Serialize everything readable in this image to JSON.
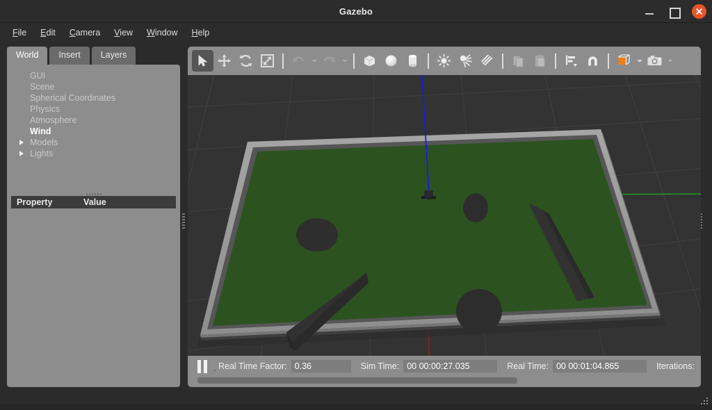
{
  "window": {
    "title": "Gazebo",
    "controls": {
      "minimize": "minimize-button",
      "maximize": "maximize-button",
      "close": "close-button"
    },
    "accent_close": "#e8552a"
  },
  "menubar": {
    "items": [
      {
        "label": "File",
        "mnemonic": "F"
      },
      {
        "label": "Edit",
        "mnemonic": "E"
      },
      {
        "label": "Camera",
        "mnemonic": "C"
      },
      {
        "label": "View",
        "mnemonic": "V"
      },
      {
        "label": "Window",
        "mnemonic": "W"
      },
      {
        "label": "Help",
        "mnemonic": "H"
      }
    ]
  },
  "left_panel": {
    "tabs": [
      {
        "label": "World",
        "active": true
      },
      {
        "label": "Insert",
        "active": false
      },
      {
        "label": "Layers",
        "active": false
      }
    ],
    "tree": [
      {
        "label": "GUI",
        "expandable": false,
        "selected": false
      },
      {
        "label": "Scene",
        "expandable": false,
        "selected": false
      },
      {
        "label": "Spherical Coordinates",
        "expandable": false,
        "selected": false
      },
      {
        "label": "Physics",
        "expandable": false,
        "selected": false
      },
      {
        "label": "Atmosphere",
        "expandable": false,
        "selected": false
      },
      {
        "label": "Wind",
        "expandable": false,
        "selected": true
      },
      {
        "label": "Models",
        "expandable": true,
        "selected": false
      },
      {
        "label": "Lights",
        "expandable": true,
        "selected": false
      }
    ],
    "property_table": {
      "columns": [
        "Property",
        "Value"
      ],
      "rows": []
    }
  },
  "toolbar": {
    "buttons": [
      {
        "name": "select-mode-button",
        "icon": "cursor-arrow-icon",
        "state": "pressed"
      },
      {
        "name": "translate-mode-button",
        "icon": "move-arrows-icon",
        "state": "normal"
      },
      {
        "name": "rotate-mode-button",
        "icon": "rotate-arrows-icon",
        "state": "normal"
      },
      {
        "name": "scale-mode-button",
        "icon": "scale-arrow-icon",
        "state": "normal"
      },
      {
        "name": "undo-button",
        "icon": "undo-arrow-icon",
        "state": "disabled"
      },
      {
        "name": "undo-history-dropdown",
        "icon": "chevron-down-icon",
        "state": "disabled"
      },
      {
        "name": "redo-button",
        "icon": "redo-arrow-icon",
        "state": "disabled"
      },
      {
        "name": "redo-history-dropdown",
        "icon": "chevron-down-icon",
        "state": "disabled"
      },
      {
        "name": "insert-box-button",
        "icon": "box-icon",
        "state": "normal"
      },
      {
        "name": "insert-sphere-button",
        "icon": "sphere-icon",
        "state": "normal"
      },
      {
        "name": "insert-cylinder-button",
        "icon": "cylinder-icon",
        "state": "normal"
      },
      {
        "name": "insert-point-light-button",
        "icon": "point-light-icon",
        "state": "normal"
      },
      {
        "name": "insert-spot-light-button",
        "icon": "spot-light-icon",
        "state": "normal"
      },
      {
        "name": "insert-directional-light-button",
        "icon": "directional-light-icon",
        "state": "normal"
      },
      {
        "name": "copy-button",
        "icon": "copy-icon",
        "state": "disabled"
      },
      {
        "name": "paste-button",
        "icon": "paste-icon",
        "state": "disabled"
      },
      {
        "name": "align-button",
        "icon": "align-icon",
        "state": "normal"
      },
      {
        "name": "snap-button",
        "icon": "magnet-icon",
        "state": "normal"
      },
      {
        "name": "view-angle-button",
        "icon": "orange-cube-icon",
        "state": "normal"
      },
      {
        "name": "screenshot-button",
        "icon": "camera-icon",
        "state": "normal"
      },
      {
        "name": "toolbar-overflow-button",
        "icon": "chevron-down-icon",
        "state": "normal"
      }
    ]
  },
  "statusbar": {
    "pause_button_label": "pause-simulation",
    "real_time_factor_label": "Real Time Factor:",
    "real_time_factor_value": "0.36",
    "sim_time_label": "Sim Time:",
    "sim_time_value": "00 00:00:27.035",
    "real_time_label": "Real Time:",
    "real_time_value": "00 00:01:04.865",
    "iterations_label": "Iterations:",
    "iterations_value": ""
  },
  "viewport": {
    "background_color": "#333333",
    "grid_color": "#454545",
    "axes": {
      "x_axis_color": "#8e2020",
      "y_axis_color": "#1f9c2a",
      "z_axis_color": "#1a1ae0"
    },
    "scene": {
      "name": "walled-arena-with-obstacles",
      "floor_color": "#2c5220",
      "wall_color": "#9a9a9a",
      "wall_shadow_color": "#4a4a4a",
      "obstacle_color": "#2f2f2f",
      "robot": {
        "name": "mobile-robot",
        "color": "#262626"
      },
      "cylinders": 3,
      "boxes": 2
    }
  },
  "bottom_strip": {
    "clipped_text": ""
  }
}
